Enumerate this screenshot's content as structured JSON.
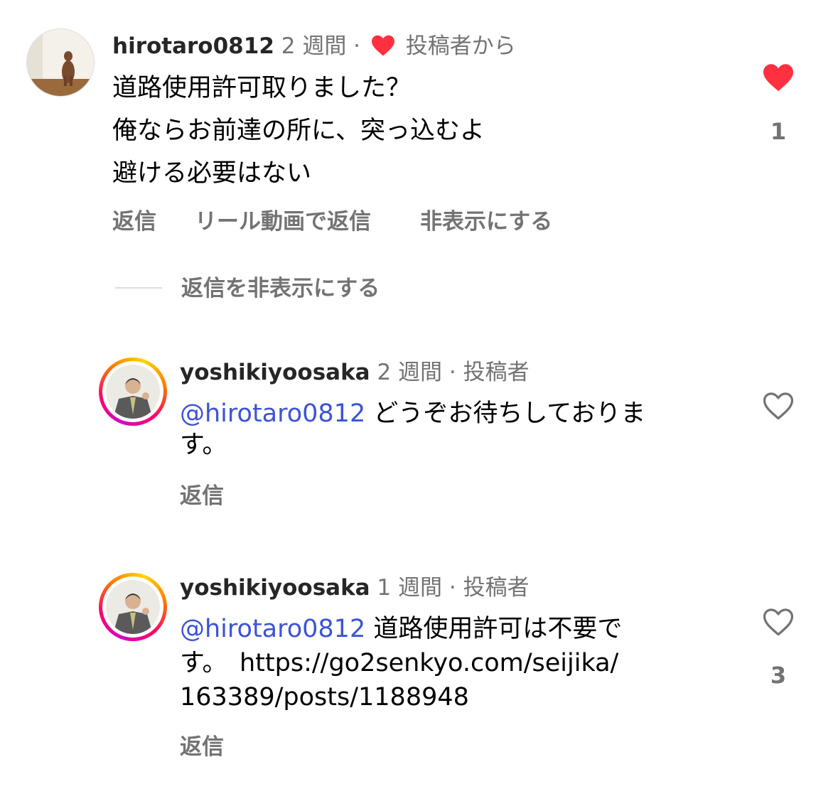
{
  "comments": [
    {
      "username": "hirotaro0812",
      "time": "2 週間 ·",
      "creator_like_label": "投稿者から",
      "lines": [
        "道路使用許可取りました？",
        "俺ならお前達の所に、突っ込むよ",
        "避ける必要はない"
      ],
      "actions": [
        "返信",
        "リール動画で返信",
        "非表示にする"
      ],
      "like_count": "1",
      "liked": true
    }
  ],
  "hide_replies_label": "返信を非表示にする",
  "replies": [
    {
      "username": "yoshikiyoosaka",
      "time": "2 週間 · 投稿者",
      "mention": "@hirotaro0812",
      "line1_rest": " どうぞお待ちしておりま",
      "line2": "す。",
      "reply_label": "返信",
      "like_count": ""
    },
    {
      "username": "yoshikiyoosaka",
      "time": "1 週間 · 投稿者",
      "mention": "@hirotaro0812",
      "line1_rest": " 道路使用許可は不要で",
      "line2": "す。　https://go2senkyo.com/seijika/",
      "line3": "163389/posts/1188948",
      "reply_label": "返信",
      "like_count": "3"
    }
  ],
  "colors": {
    "like_red": "#ff3040",
    "mention_blue": "#3d53d6",
    "secondary_gray": "#737373"
  },
  "icons": [
    "heart-filled-icon",
    "heart-outline-icon"
  ]
}
